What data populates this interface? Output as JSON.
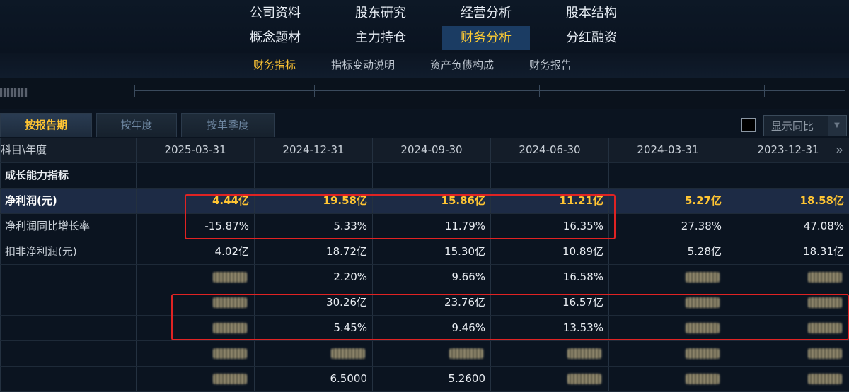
{
  "nav": {
    "row1": [
      "公司资料",
      "股东研究",
      "经营分析",
      "股本结构"
    ],
    "row2": [
      "概念题材",
      "主力持仓",
      "财务分析",
      "分红融资"
    ]
  },
  "subnav": [
    "财务指标",
    "指标变动说明",
    "资产负债构成",
    "财务报告"
  ],
  "tabs": [
    "按报告期",
    "按年度",
    "按单季度"
  ],
  "toggle": {
    "label": "显示同比"
  },
  "table": {
    "header_label": "科目\\年度",
    "periods": [
      "2025-03-31",
      "2024-12-31",
      "2024-09-30",
      "2024-06-30",
      "2024-03-31",
      "2023-12-31"
    ],
    "section": "成长能力指标",
    "rows": [
      {
        "label": "净利润(元)",
        "values": [
          "4.44亿",
          "19.58亿",
          "15.86亿",
          "11.21亿",
          "5.27亿",
          "18.58亿"
        ]
      },
      {
        "label": "净利润同比增长率",
        "values": [
          "-15.87%",
          "5.33%",
          "11.79%",
          "16.35%",
          "27.38%",
          "47.08%"
        ]
      },
      {
        "label": "扣非净利润(元)",
        "values": [
          "4.02亿",
          "18.72亿",
          "15.30亿",
          "10.89亿",
          "5.28亿",
          "18.31亿"
        ]
      },
      {
        "label": "",
        "values": [
          "",
          "2.20%",
          "9.66%",
          "16.58%",
          "",
          ""
        ]
      },
      {
        "label": "",
        "values": [
          "",
          "30.26亿",
          "23.76亿",
          "16.57亿",
          "",
          ""
        ]
      },
      {
        "label": "",
        "values": [
          "",
          "5.45%",
          "9.46%",
          "13.53%",
          "",
          ""
        ]
      },
      {
        "label": "",
        "values": [
          "",
          "",
          "",
          "",
          "",
          ""
        ]
      },
      {
        "label": "",
        "values": [
          "",
          "6.5000",
          "5.2600",
          "",
          "",
          ""
        ]
      }
    ]
  },
  "colors": {
    "accent": "#ffc533",
    "highlight_box": "#e02323",
    "background": "#0b1420"
  }
}
